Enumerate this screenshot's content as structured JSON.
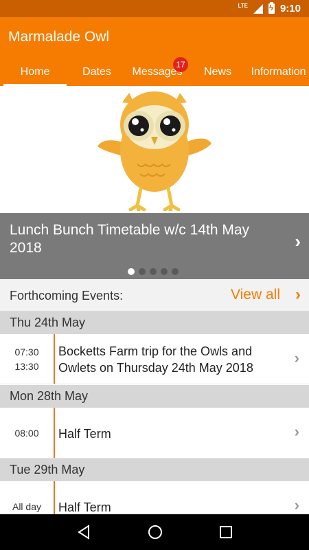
{
  "status_bar": {
    "network": "LTE",
    "time": "9:10"
  },
  "app": {
    "title": "Marmalade Owl"
  },
  "tabs": [
    {
      "label": "Home",
      "active": true
    },
    {
      "label": "Dates"
    },
    {
      "label": "Messages",
      "badge": "17"
    },
    {
      "label": "News"
    },
    {
      "label": "Information"
    }
  ],
  "banner": {
    "title": "Lunch Bunch Timetable w/c 14th May 2018",
    "slide_count": 5,
    "active_slide": 1
  },
  "events": {
    "header": "Forthcoming Events:",
    "view_all": "View all",
    "groups": [
      {
        "date": "Thu 24th May",
        "items": [
          {
            "time_start": "07:30",
            "time_end": "13:30",
            "title": "Bocketts Farm trip for the Owls and Owlets on Thursday 24th May 2018"
          }
        ]
      },
      {
        "date": "Mon 28th May",
        "items": [
          {
            "time_start": "08:00",
            "title": "Half Term"
          }
        ]
      },
      {
        "date": "Tue 29th May",
        "items": [
          {
            "time_start": "All day",
            "title": "Half Term"
          }
        ]
      }
    ]
  },
  "colors": {
    "primary": "#f57c00",
    "status_bar": "#c95f00",
    "banner": "#7a7a7a",
    "badge": "#e3221c"
  }
}
